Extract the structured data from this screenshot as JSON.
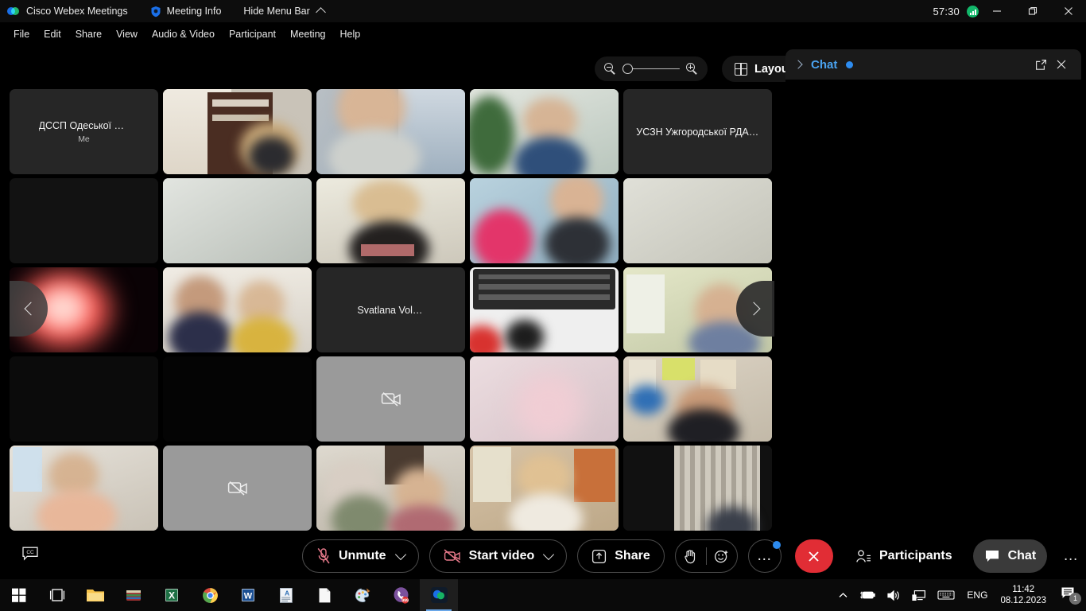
{
  "titlebar": {
    "app_name": "Cisco Webex Meetings",
    "logo_icon": "webex-logo-icon",
    "meeting_info_label": "Meeting Info",
    "meeting_info_icon": "shield-icon",
    "hide_menu_label": "Hide Menu Bar",
    "hide_menu_icon": "caret-up-icon",
    "timer": "57:30",
    "signal_icon": "signal-strength-icon",
    "minimize_icon": "minimize-icon",
    "maximize_icon": "maximize-icon",
    "close_icon": "close-icon"
  },
  "menubar": {
    "items": [
      {
        "label": "File"
      },
      {
        "label": "Edit"
      },
      {
        "label": "Share"
      },
      {
        "label": "View"
      },
      {
        "label": "Audio & Video"
      },
      {
        "label": "Participant"
      },
      {
        "label": "Meeting"
      },
      {
        "label": "Help"
      }
    ]
  },
  "stage_tools": {
    "zoom_out_icon": "zoom-out-icon",
    "zoom_in_icon": "zoom-in-icon",
    "zoom_value_percent": 0,
    "layout_label": "Layout",
    "layout_icon": "grid-layout-icon"
  },
  "grid": {
    "rows": 5,
    "cols": 5,
    "prev_icon": "chevron-left-icon",
    "next_icon": "chevron-right-icon",
    "tiles": [
      {
        "name": "ДССП Одеської ОДА",
        "sub": "Me",
        "kind": "name",
        "bg": "#262626"
      },
      {
        "name": "",
        "kind": "video",
        "bg": "#c9c3b8"
      },
      {
        "name": "",
        "kind": "video",
        "bg": "#b8bcc0"
      },
      {
        "name": "",
        "kind": "video",
        "bg": "#c2cbc6"
      },
      {
        "name": "УСЗН Ужгородської РДА П...",
        "kind": "name",
        "bg": "#262626"
      },
      {
        "name": "",
        "kind": "video",
        "bg": "#121212"
      },
      {
        "name": "",
        "kind": "video",
        "bg": "#cfd3ce"
      },
      {
        "name": "",
        "kind": "video",
        "bg": "#d9d5cc"
      },
      {
        "name": "",
        "kind": "video",
        "bg": "#a9c6d4"
      },
      {
        "name": "",
        "kind": "video",
        "bg": "#d6d6cf"
      },
      {
        "name": "",
        "kind": "video",
        "bg": "#1a0708"
      },
      {
        "name": "",
        "kind": "video",
        "bg": "#e0ddd6"
      },
      {
        "name": "Svatlana Volkun",
        "kind": "name",
        "bg": "#262626"
      },
      {
        "name": "",
        "kind": "video",
        "bg": "#2a2a2a"
      },
      {
        "name": "",
        "kind": "video",
        "bg": "#cfd4bf"
      },
      {
        "name": "",
        "kind": "video",
        "bg": "#0d0d0d"
      },
      {
        "name": "",
        "kind": "video",
        "bg": "#050505"
      },
      {
        "name": "",
        "kind": "camera-off",
        "bg": "#9a9a9a"
      },
      {
        "name": "",
        "kind": "video",
        "bg": "#e3d3d6"
      },
      {
        "name": "",
        "kind": "video",
        "bg": "#cdc3b5"
      },
      {
        "name": "",
        "kind": "video",
        "bg": "#cfc9c2"
      },
      {
        "name": "",
        "kind": "camera-off",
        "bg": "#9a9a9a"
      },
      {
        "name": "",
        "kind": "video",
        "bg": "#c9c5bd"
      },
      {
        "name": "",
        "kind": "video",
        "bg": "#cdbfae"
      },
      {
        "name": "",
        "kind": "video",
        "bg": "#1c1c1c"
      }
    ]
  },
  "chat_panel": {
    "collapse_icon": "chevron-right-icon",
    "title": "Chat",
    "unread_dot": true,
    "popout_icon": "pop-out-icon",
    "close_icon": "close-icon",
    "messages": []
  },
  "bottom_bar": {
    "cc_icon": "closed-captions-icon",
    "mute_label": "Unmute",
    "mute_icon": "mic-muted-icon",
    "mute_chevron_icon": "chevron-down-icon",
    "video_label": "Start video",
    "video_icon": "camera-off-icon",
    "video_chevron_icon": "chevron-down-icon",
    "share_label": "Share",
    "share_icon": "share-screen-icon",
    "hand_icon": "raise-hand-icon",
    "reaction_icon": "reactions-icon",
    "more_label": "…",
    "more_icon": "more-options-icon",
    "more_badge": true,
    "end_icon": "end-meeting-icon",
    "participants_label": "Participants",
    "participants_icon": "participants-icon",
    "chat_label": "Chat",
    "chat_icon": "chat-bubble-icon",
    "chat_active": true,
    "overflow_label": "…",
    "overflow_icon": "overflow-menu-icon"
  },
  "taskbar": {
    "items": [
      {
        "name": "start-button",
        "icon": "windows-logo-icon"
      },
      {
        "name": "task-view-button",
        "icon": "task-view-icon"
      },
      {
        "name": "file-explorer",
        "icon": "folder-icon"
      },
      {
        "name": "winrar",
        "icon": "winrar-icon"
      },
      {
        "name": "excel",
        "icon": "excel-icon"
      },
      {
        "name": "chrome",
        "icon": "chrome-icon"
      },
      {
        "name": "word",
        "icon": "word-icon"
      },
      {
        "name": "document-viewer",
        "icon": "document-icon"
      },
      {
        "name": "notepad",
        "icon": "blank-page-icon"
      },
      {
        "name": "paint",
        "icon": "paint-palette-icon"
      },
      {
        "name": "viber",
        "icon": "viber-icon",
        "badge": "999"
      },
      {
        "name": "webex",
        "icon": "webex-icon",
        "active": true
      }
    ],
    "tray": {
      "show_hidden_icon": "chevron-up-icon",
      "battery_icon": "battery-charging-icon",
      "volume_icon": "speaker-icon",
      "network_icon": "network-monitor-icon",
      "keyboard_icon": "keyboard-icon",
      "language": "ENG",
      "time": "11:42",
      "date": "08.12.2023",
      "notifications_icon": "notifications-icon",
      "notifications_badge": "1"
    }
  },
  "colors": {
    "accent_blue": "#2d8cf0",
    "chat_title": "#4aa3f0",
    "end_red": "#e12d35",
    "signal_green": "#12b76a",
    "mute_red": "#e87a8b"
  }
}
